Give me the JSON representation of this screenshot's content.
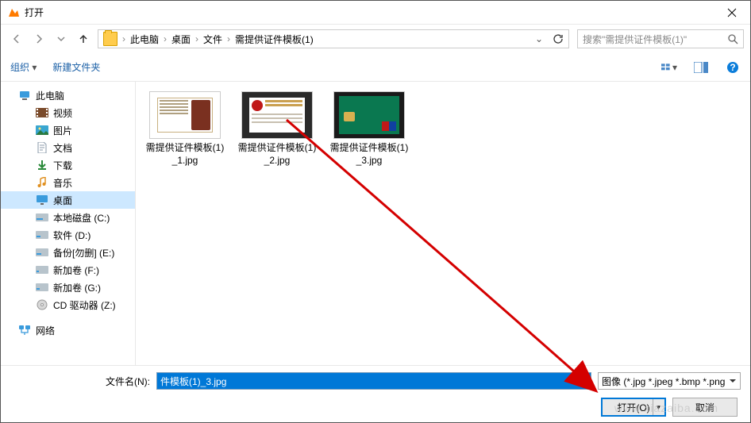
{
  "title": "打开",
  "breadcrumb": [
    "此电脑",
    "桌面",
    "文件",
    "需提供证件模板(1)"
  ],
  "search_placeholder": "搜索\"需提供证件模板(1)\"",
  "toolbar": {
    "organize": "组织",
    "newfolder": "新建文件夹"
  },
  "sidebar": {
    "thispc": "此电脑",
    "items": [
      "视频",
      "图片",
      "文档",
      "下载",
      "音乐",
      "桌面",
      "本地磁盘 (C:)",
      "软件 (D:)",
      "备份[勿删] (E:)",
      "新加卷 (F:)",
      "新加卷 (G:)",
      "CD 驱动器 (Z:)"
    ],
    "network": "网络"
  },
  "files": [
    {
      "name": "需提供证件模板(1)_1.jpg"
    },
    {
      "name": "需提供证件模板(1)_2.jpg"
    },
    {
      "name": "需提供证件模板(1)_3.jpg"
    }
  ],
  "bottom": {
    "label": "文件名(N):",
    "value": "件模板(1)_3.jpg",
    "filter": "图像 (*.jpg *.jpeg *.bmp *.png",
    "open": "打开(O)",
    "cancel": "取消"
  },
  "watermark": "www.xiazaiba.com"
}
